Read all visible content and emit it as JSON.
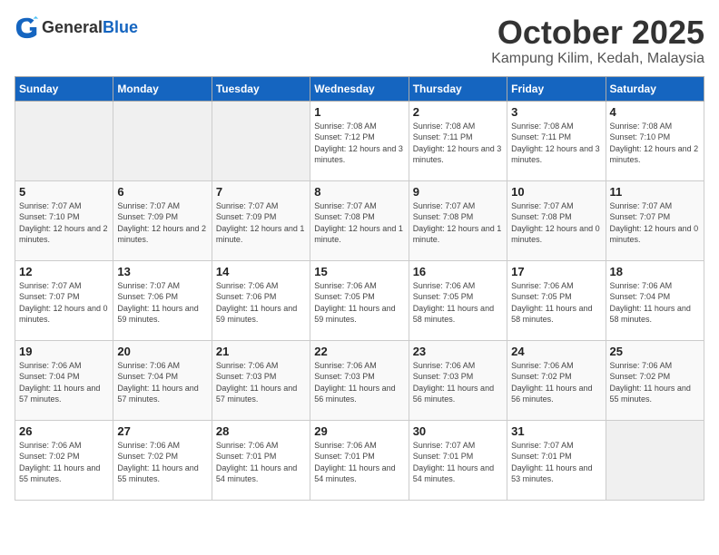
{
  "header": {
    "logo_general": "General",
    "logo_blue": "Blue",
    "month": "October 2025",
    "location": "Kampung Kilim, Kedah, Malaysia"
  },
  "weekdays": [
    "Sunday",
    "Monday",
    "Tuesday",
    "Wednesday",
    "Thursday",
    "Friday",
    "Saturday"
  ],
  "weeks": [
    [
      {
        "day": "",
        "info": ""
      },
      {
        "day": "",
        "info": ""
      },
      {
        "day": "",
        "info": ""
      },
      {
        "day": "1",
        "info": "Sunrise: 7:08 AM\nSunset: 7:12 PM\nDaylight: 12 hours and 3 minutes."
      },
      {
        "day": "2",
        "info": "Sunrise: 7:08 AM\nSunset: 7:11 PM\nDaylight: 12 hours and 3 minutes."
      },
      {
        "day": "3",
        "info": "Sunrise: 7:08 AM\nSunset: 7:11 PM\nDaylight: 12 hours and 3 minutes."
      },
      {
        "day": "4",
        "info": "Sunrise: 7:08 AM\nSunset: 7:10 PM\nDaylight: 12 hours and 2 minutes."
      }
    ],
    [
      {
        "day": "5",
        "info": "Sunrise: 7:07 AM\nSunset: 7:10 PM\nDaylight: 12 hours and 2 minutes."
      },
      {
        "day": "6",
        "info": "Sunrise: 7:07 AM\nSunset: 7:09 PM\nDaylight: 12 hours and 2 minutes."
      },
      {
        "day": "7",
        "info": "Sunrise: 7:07 AM\nSunset: 7:09 PM\nDaylight: 12 hours and 1 minute."
      },
      {
        "day": "8",
        "info": "Sunrise: 7:07 AM\nSunset: 7:08 PM\nDaylight: 12 hours and 1 minute."
      },
      {
        "day": "9",
        "info": "Sunrise: 7:07 AM\nSunset: 7:08 PM\nDaylight: 12 hours and 1 minute."
      },
      {
        "day": "10",
        "info": "Sunrise: 7:07 AM\nSunset: 7:08 PM\nDaylight: 12 hours and 0 minutes."
      },
      {
        "day": "11",
        "info": "Sunrise: 7:07 AM\nSunset: 7:07 PM\nDaylight: 12 hours and 0 minutes."
      }
    ],
    [
      {
        "day": "12",
        "info": "Sunrise: 7:07 AM\nSunset: 7:07 PM\nDaylight: 12 hours and 0 minutes."
      },
      {
        "day": "13",
        "info": "Sunrise: 7:07 AM\nSunset: 7:06 PM\nDaylight: 11 hours and 59 minutes."
      },
      {
        "day": "14",
        "info": "Sunrise: 7:06 AM\nSunset: 7:06 PM\nDaylight: 11 hours and 59 minutes."
      },
      {
        "day": "15",
        "info": "Sunrise: 7:06 AM\nSunset: 7:05 PM\nDaylight: 11 hours and 59 minutes."
      },
      {
        "day": "16",
        "info": "Sunrise: 7:06 AM\nSunset: 7:05 PM\nDaylight: 11 hours and 58 minutes."
      },
      {
        "day": "17",
        "info": "Sunrise: 7:06 AM\nSunset: 7:05 PM\nDaylight: 11 hours and 58 minutes."
      },
      {
        "day": "18",
        "info": "Sunrise: 7:06 AM\nSunset: 7:04 PM\nDaylight: 11 hours and 58 minutes."
      }
    ],
    [
      {
        "day": "19",
        "info": "Sunrise: 7:06 AM\nSunset: 7:04 PM\nDaylight: 11 hours and 57 minutes."
      },
      {
        "day": "20",
        "info": "Sunrise: 7:06 AM\nSunset: 7:04 PM\nDaylight: 11 hours and 57 minutes."
      },
      {
        "day": "21",
        "info": "Sunrise: 7:06 AM\nSunset: 7:03 PM\nDaylight: 11 hours and 57 minutes."
      },
      {
        "day": "22",
        "info": "Sunrise: 7:06 AM\nSunset: 7:03 PM\nDaylight: 11 hours and 56 minutes."
      },
      {
        "day": "23",
        "info": "Sunrise: 7:06 AM\nSunset: 7:03 PM\nDaylight: 11 hours and 56 minutes."
      },
      {
        "day": "24",
        "info": "Sunrise: 7:06 AM\nSunset: 7:02 PM\nDaylight: 11 hours and 56 minutes."
      },
      {
        "day": "25",
        "info": "Sunrise: 7:06 AM\nSunset: 7:02 PM\nDaylight: 11 hours and 55 minutes."
      }
    ],
    [
      {
        "day": "26",
        "info": "Sunrise: 7:06 AM\nSunset: 7:02 PM\nDaylight: 11 hours and 55 minutes."
      },
      {
        "day": "27",
        "info": "Sunrise: 7:06 AM\nSunset: 7:02 PM\nDaylight: 11 hours and 55 minutes."
      },
      {
        "day": "28",
        "info": "Sunrise: 7:06 AM\nSunset: 7:01 PM\nDaylight: 11 hours and 54 minutes."
      },
      {
        "day": "29",
        "info": "Sunrise: 7:06 AM\nSunset: 7:01 PM\nDaylight: 11 hours and 54 minutes."
      },
      {
        "day": "30",
        "info": "Sunrise: 7:07 AM\nSunset: 7:01 PM\nDaylight: 11 hours and 54 minutes."
      },
      {
        "day": "31",
        "info": "Sunrise: 7:07 AM\nSunset: 7:01 PM\nDaylight: 11 hours and 53 minutes."
      },
      {
        "day": "",
        "info": ""
      }
    ]
  ]
}
